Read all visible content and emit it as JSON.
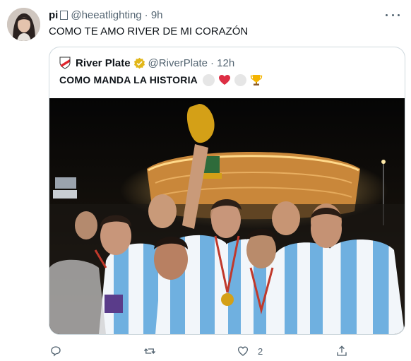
{
  "tweet": {
    "display_name": "pi",
    "handle": "@heeatlighting",
    "time": "· 9h",
    "text": "COMO TE AMO RIVER DE MI CORAZÓN"
  },
  "quote": {
    "display_name": "River Plate",
    "handle": "@RiverPlate",
    "time": "· 12h",
    "text": "COMO MANDA LA HISTORIA",
    "emojis": [
      "white-circle",
      "red-heart",
      "white-circle",
      "trophy"
    ]
  },
  "actions": {
    "reply_count": "",
    "retweet_count": "",
    "like_count": "2",
    "share_count": ""
  },
  "colors": {
    "verified_gold": "#e2b719",
    "muted_text": "#536471",
    "heart_red": "#dd2e44",
    "border": "#cfd9de"
  }
}
